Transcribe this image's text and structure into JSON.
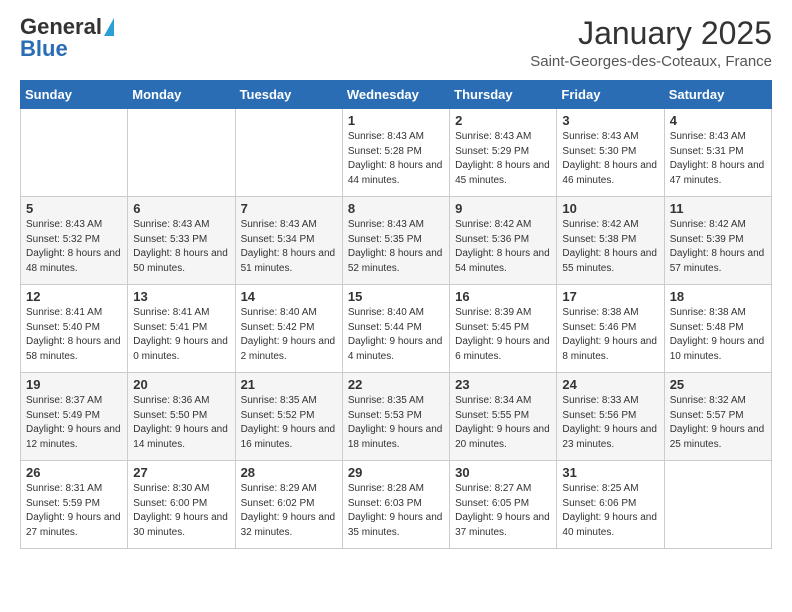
{
  "header": {
    "logo_general": "General",
    "logo_blue": "Blue",
    "month_title": "January 2025",
    "location": "Saint-Georges-des-Coteaux, France"
  },
  "days_of_week": [
    "Sunday",
    "Monday",
    "Tuesday",
    "Wednesday",
    "Thursday",
    "Friday",
    "Saturday"
  ],
  "weeks": [
    [
      {
        "day": null
      },
      {
        "day": null
      },
      {
        "day": null
      },
      {
        "day": "1",
        "sunrise": "8:43 AM",
        "sunset": "5:28 PM",
        "daylight": "8 hours and 44 minutes."
      },
      {
        "day": "2",
        "sunrise": "8:43 AM",
        "sunset": "5:29 PM",
        "daylight": "8 hours and 45 minutes."
      },
      {
        "day": "3",
        "sunrise": "8:43 AM",
        "sunset": "5:30 PM",
        "daylight": "8 hours and 46 minutes."
      },
      {
        "day": "4",
        "sunrise": "8:43 AM",
        "sunset": "5:31 PM",
        "daylight": "8 hours and 47 minutes."
      }
    ],
    [
      {
        "day": "5",
        "sunrise": "8:43 AM",
        "sunset": "5:32 PM",
        "daylight": "8 hours and 48 minutes."
      },
      {
        "day": "6",
        "sunrise": "8:43 AM",
        "sunset": "5:33 PM",
        "daylight": "8 hours and 50 minutes."
      },
      {
        "day": "7",
        "sunrise": "8:43 AM",
        "sunset": "5:34 PM",
        "daylight": "8 hours and 51 minutes."
      },
      {
        "day": "8",
        "sunrise": "8:43 AM",
        "sunset": "5:35 PM",
        "daylight": "8 hours and 52 minutes."
      },
      {
        "day": "9",
        "sunrise": "8:42 AM",
        "sunset": "5:36 PM",
        "daylight": "8 hours and 54 minutes."
      },
      {
        "day": "10",
        "sunrise": "8:42 AM",
        "sunset": "5:38 PM",
        "daylight": "8 hours and 55 minutes."
      },
      {
        "day": "11",
        "sunrise": "8:42 AM",
        "sunset": "5:39 PM",
        "daylight": "8 hours and 57 minutes."
      }
    ],
    [
      {
        "day": "12",
        "sunrise": "8:41 AM",
        "sunset": "5:40 PM",
        "daylight": "8 hours and 58 minutes."
      },
      {
        "day": "13",
        "sunrise": "8:41 AM",
        "sunset": "5:41 PM",
        "daylight": "9 hours and 0 minutes."
      },
      {
        "day": "14",
        "sunrise": "8:40 AM",
        "sunset": "5:42 PM",
        "daylight": "9 hours and 2 minutes."
      },
      {
        "day": "15",
        "sunrise": "8:40 AM",
        "sunset": "5:44 PM",
        "daylight": "9 hours and 4 minutes."
      },
      {
        "day": "16",
        "sunrise": "8:39 AM",
        "sunset": "5:45 PM",
        "daylight": "9 hours and 6 minutes."
      },
      {
        "day": "17",
        "sunrise": "8:38 AM",
        "sunset": "5:46 PM",
        "daylight": "9 hours and 8 minutes."
      },
      {
        "day": "18",
        "sunrise": "8:38 AM",
        "sunset": "5:48 PM",
        "daylight": "9 hours and 10 minutes."
      }
    ],
    [
      {
        "day": "19",
        "sunrise": "8:37 AM",
        "sunset": "5:49 PM",
        "daylight": "9 hours and 12 minutes."
      },
      {
        "day": "20",
        "sunrise": "8:36 AM",
        "sunset": "5:50 PM",
        "daylight": "9 hours and 14 minutes."
      },
      {
        "day": "21",
        "sunrise": "8:35 AM",
        "sunset": "5:52 PM",
        "daylight": "9 hours and 16 minutes."
      },
      {
        "day": "22",
        "sunrise": "8:35 AM",
        "sunset": "5:53 PM",
        "daylight": "9 hours and 18 minutes."
      },
      {
        "day": "23",
        "sunrise": "8:34 AM",
        "sunset": "5:55 PM",
        "daylight": "9 hours and 20 minutes."
      },
      {
        "day": "24",
        "sunrise": "8:33 AM",
        "sunset": "5:56 PM",
        "daylight": "9 hours and 23 minutes."
      },
      {
        "day": "25",
        "sunrise": "8:32 AM",
        "sunset": "5:57 PM",
        "daylight": "9 hours and 25 minutes."
      }
    ],
    [
      {
        "day": "26",
        "sunrise": "8:31 AM",
        "sunset": "5:59 PM",
        "daylight": "9 hours and 27 minutes."
      },
      {
        "day": "27",
        "sunrise": "8:30 AM",
        "sunset": "6:00 PM",
        "daylight": "9 hours and 30 minutes."
      },
      {
        "day": "28",
        "sunrise": "8:29 AM",
        "sunset": "6:02 PM",
        "daylight": "9 hours and 32 minutes."
      },
      {
        "day": "29",
        "sunrise": "8:28 AM",
        "sunset": "6:03 PM",
        "daylight": "9 hours and 35 minutes."
      },
      {
        "day": "30",
        "sunrise": "8:27 AM",
        "sunset": "6:05 PM",
        "daylight": "9 hours and 37 minutes."
      },
      {
        "day": "31",
        "sunrise": "8:25 AM",
        "sunset": "6:06 PM",
        "daylight": "9 hours and 40 minutes."
      },
      {
        "day": null
      }
    ]
  ]
}
